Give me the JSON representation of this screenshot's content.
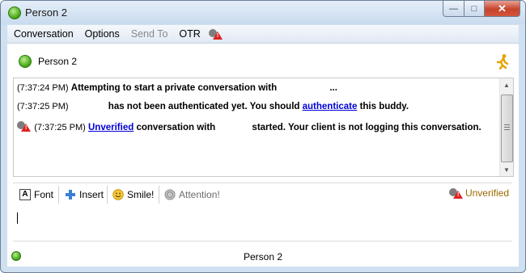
{
  "window": {
    "title": "Person 2",
    "min_label": "—",
    "max_label": "□",
    "close_label": "✕"
  },
  "menu": [
    {
      "label": "Conversation",
      "enabled": true
    },
    {
      "label": "Options",
      "enabled": true
    },
    {
      "label": "Send To",
      "enabled": false
    },
    {
      "label": "OTR",
      "enabled": true
    }
  ],
  "header": {
    "name": "Person 2"
  },
  "log": [
    {
      "time": "(7:37:24 PM)",
      "text": "Attempting to start a private conversation with",
      "tail": "..."
    },
    {
      "time": "(7:37:25 PM)",
      "text_a": "has not been authenticated yet.  You should ",
      "link": "authenticate",
      "text_b": " this buddy."
    },
    {
      "time": "(7:37:25 PM)",
      "link": "Unverified",
      "text_a": " conversation with",
      "text_b": "started.  Your client is not logging this conversation."
    }
  ],
  "toolbar": {
    "font": "Font",
    "insert": "Insert",
    "smile": "Smile!",
    "attention": "Attention!",
    "status": "Unverified"
  },
  "status_bar": {
    "name": "Person 2"
  },
  "colors": {
    "link": "#0000d8",
    "unverified": "#9a6a00",
    "online": "#3fa114"
  }
}
